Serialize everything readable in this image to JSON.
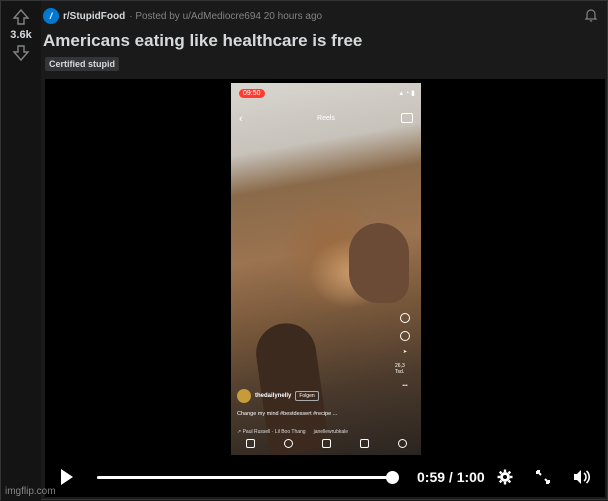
{
  "post": {
    "vote_count": "3.6k",
    "subreddit": "r/StupidFood",
    "subreddit_icon_letter": "/",
    "posted_by": "· Posted by u/AdMediocre694 20 hours ago",
    "title": "Americans eating like healthcare is free",
    "flair": "Certified stupid"
  },
  "phone": {
    "status_time": "09:50",
    "reels_label": "Reels",
    "username": "thedailynelly",
    "follow_label": "Folgen",
    "caption": "Change my mind  #bestdessert #recipe ...",
    "audio_artist": "↗ Paul Russell · Lil Boo Thang",
    "audio_source": "janellewrubkale",
    "likes_count": "26,3 Tsd."
  },
  "player": {
    "time_display": "0:59 / 1:00",
    "progress": 0.983
  },
  "watermark": "imgflip.com",
  "colors": {
    "background": "#1a1a1b",
    "text": "#d7dadc",
    "muted": "#818384",
    "subreddit_icon": "#0079d3"
  }
}
